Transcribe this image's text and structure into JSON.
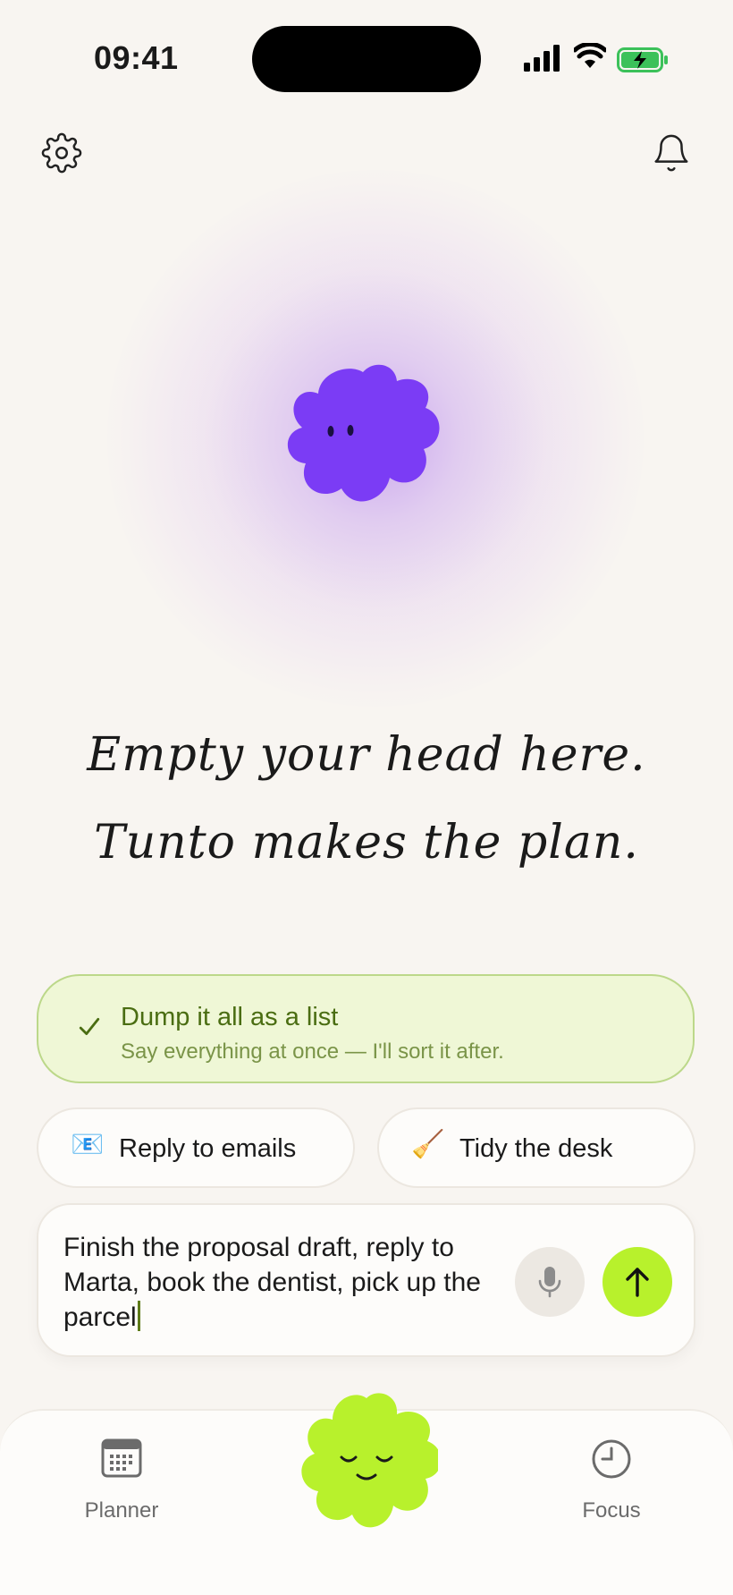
{
  "status_bar": {
    "time": "09:41",
    "icons": [
      "cellular-signal-icon",
      "wifi-icon",
      "battery-charging-icon"
    ]
  },
  "header": {
    "left_icon": "gear-icon",
    "right_icon": "bell-icon"
  },
  "hero": {
    "mascot": "purple-blob-mascot",
    "line1": "Empty your head here.",
    "line2": "Tunto makes the plan."
  },
  "suggestion": {
    "icon": "check-icon",
    "title": "Dump it all as a list",
    "subtitle": "Say everything at once — I'll sort it after."
  },
  "chips": [
    {
      "emoji": "📧",
      "label": "Reply to emails"
    },
    {
      "emoji": "🧹",
      "label": "Tidy the desk"
    }
  ],
  "composer": {
    "value": "Finish the proposal draft, reply to Marta, book the dentist, pick up the parcel",
    "mic_icon": "microphone-icon",
    "send_icon": "arrow-up-icon"
  },
  "tabbar": {
    "items": [
      {
        "label": "Planner",
        "icon": "calendar-icon"
      },
      {
        "label": "Focus",
        "icon": "clock-icon"
      }
    ],
    "center_icon": "green-blob-home-icon"
  },
  "colors": {
    "accent_green": "#b8f12c",
    "mascot_purple": "#7b3cf5",
    "suggestion_bg": "#eff7d6",
    "background": "#f8f5f1"
  }
}
